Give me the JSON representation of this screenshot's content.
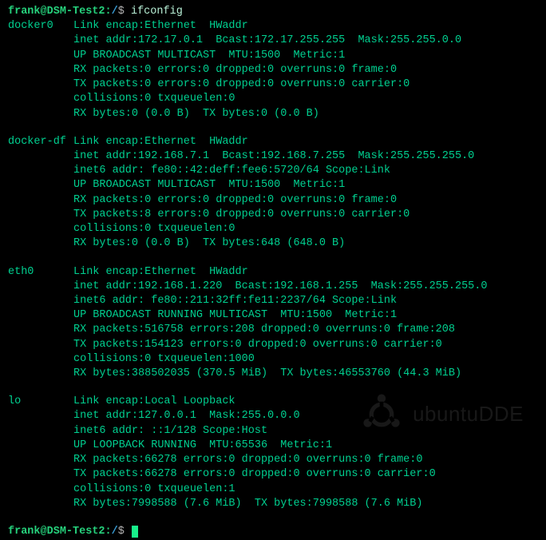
{
  "prompt": {
    "user": "frank",
    "host": "DSM-Test2",
    "path": "/",
    "symbol": "$",
    "command": "ifconfig"
  },
  "interfaces": [
    {
      "name": "docker0",
      "lines": [
        "Link encap:Ethernet  HWaddr ",
        "inet addr:172.17.0.1  Bcast:172.17.255.255  Mask:255.255.0.0",
        "UP BROADCAST MULTICAST  MTU:1500  Metric:1",
        "RX packets:0 errors:0 dropped:0 overruns:0 frame:0",
        "TX packets:0 errors:0 dropped:0 overruns:0 carrier:0",
        "collisions:0 txqueuelen:0",
        "RX bytes:0 (0.0 B)  TX bytes:0 (0.0 B)"
      ],
      "redact_first": true
    },
    {
      "name": "docker-df",
      "lines": [
        "Link encap:Ethernet  HWaddr ",
        "inet addr:192.168.7.1  Bcast:192.168.7.255  Mask:255.255.255.0",
        "inet6 addr: fe80::42:deff:fee6:5720/64 Scope:Link",
        "UP BROADCAST MULTICAST  MTU:1500  Metric:1",
        "RX packets:0 errors:0 dropped:0 overruns:0 frame:0",
        "TX packets:8 errors:0 dropped:0 overruns:0 carrier:0",
        "collisions:0 txqueuelen:0",
        "RX bytes:0 (0.0 B)  TX bytes:648 (648.0 B)"
      ],
      "redact_first": true
    },
    {
      "name": "eth0",
      "lines": [
        "Link encap:Ethernet  HWaddr ",
        "inet addr:192.168.1.220  Bcast:192.168.1.255  Mask:255.255.255.0",
        "inet6 addr: fe80::211:32ff:fe11:2237/64 Scope:Link",
        "UP BROADCAST RUNNING MULTICAST  MTU:1500  Metric:1",
        "RX packets:516758 errors:208 dropped:0 overruns:0 frame:208",
        "TX packets:154123 errors:0 dropped:0 overruns:0 carrier:0",
        "collisions:0 txqueuelen:1000",
        "RX bytes:388502035 (370.5 MiB)  TX bytes:46553760 (44.3 MiB)"
      ],
      "redact_first": true
    },
    {
      "name": "lo",
      "lines": [
        "Link encap:Local Loopback",
        "inet addr:127.0.0.1  Mask:255.0.0.0",
        "inet6 addr: ::1/128 Scope:Host",
        "UP LOOPBACK RUNNING  MTU:65536  Metric:1",
        "RX packets:66278 errors:0 dropped:0 overruns:0 frame:0",
        "TX packets:66278 errors:0 dropped:0 overruns:0 carrier:0",
        "collisions:0 txqueuelen:1",
        "RX bytes:7998588 (7.6 MiB)  TX bytes:7998588 (7.6 MiB)"
      ],
      "redact_first": false
    }
  ],
  "watermark": {
    "text": "ubuntuDDE"
  }
}
